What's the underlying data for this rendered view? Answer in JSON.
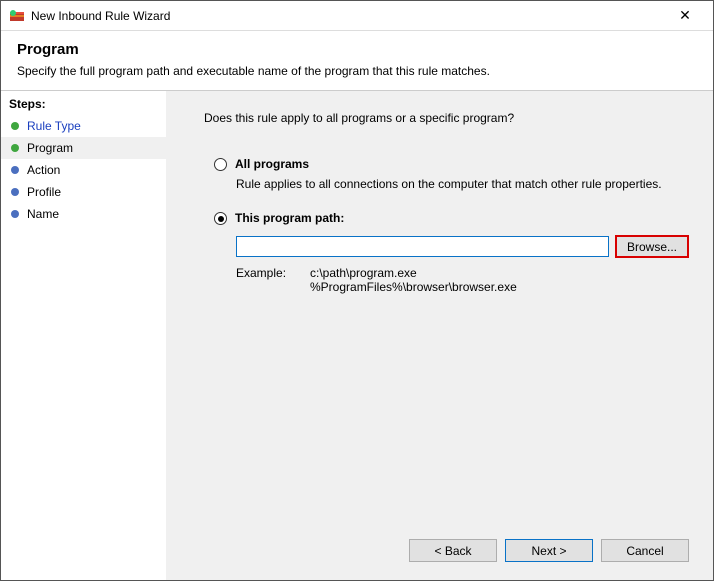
{
  "window": {
    "title": "New Inbound Rule Wizard",
    "close_glyph": "✕"
  },
  "header": {
    "heading": "Program",
    "subtitle": "Specify the full program path and executable name of the program that this rule matches."
  },
  "steps": {
    "title": "Steps:",
    "items": [
      {
        "label": "Rule Type"
      },
      {
        "label": "Program"
      },
      {
        "label": "Action"
      },
      {
        "label": "Profile"
      },
      {
        "label": "Name"
      }
    ]
  },
  "content": {
    "question": "Does this rule apply to all programs or a specific program?",
    "opt_all": {
      "label": "All programs",
      "desc": "Rule applies to all connections on the computer that match other rule properties."
    },
    "opt_path": {
      "label": "This program path:",
      "input_value": "",
      "browse_label": "Browse...",
      "example_label": "Example:",
      "example_lines": "c:\\path\\program.exe\n%ProgramFiles%\\browser\\browser.exe"
    }
  },
  "buttons": {
    "back": "< Back",
    "next": "Next >",
    "cancel": "Cancel"
  }
}
